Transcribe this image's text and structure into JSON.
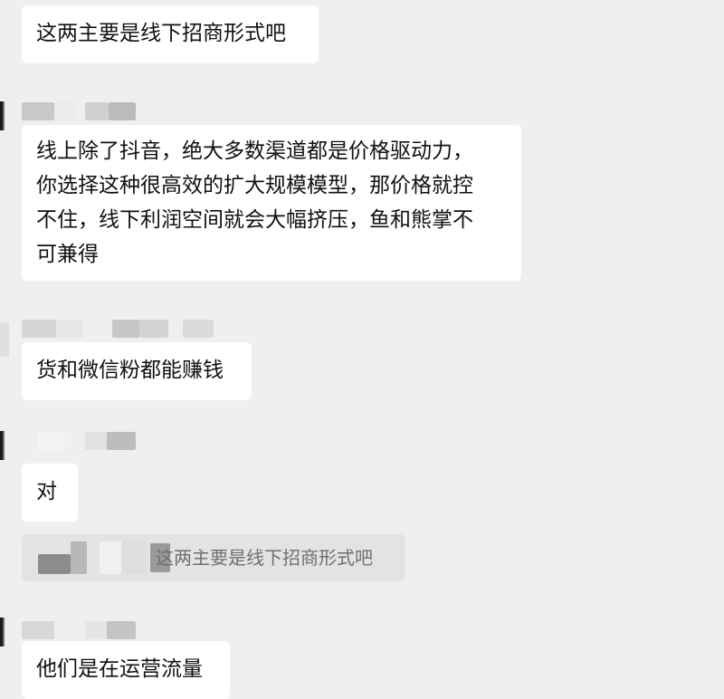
{
  "conversation": {
    "messages": [
      {
        "text": "这两主要是线下招商形式吧"
      },
      {
        "lines": [
          "线上除了抖音，绝大多数渠道都是价格驱动力，",
          "你选择这种很高效的扩大规模模型，那价格就控",
          "不住，线下利润空间就会大幅挤压，鱼和熊掌不",
          "可兼得"
        ]
      },
      {
        "text": "货和微信粉都能赚钱"
      },
      {
        "text": "对"
      },
      {
        "quote": "这两主要是线下招商形式吧"
      },
      {
        "text": "他们是在运营流量"
      }
    ]
  }
}
